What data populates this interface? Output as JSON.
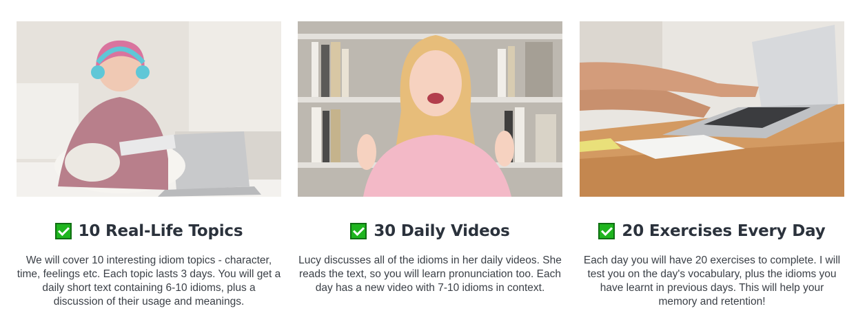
{
  "features": [
    {
      "image_alt": "Girl with headphones studying on bed with laptop",
      "title": "10 Real-Life Topics",
      "description": "We will cover 10 interesting idiom topics - character, time, feelings etc. Each topic lasts 3 days. You will get a daily short text containing 6-10 idioms, plus a discussion of their usage and meanings."
    },
    {
      "image_alt": "Smiling woman in pink sweater in front of bookshelf",
      "title": "30 Daily Videos",
      "description": "Lucy discusses all of the idioms in her daily videos. She reads the text, so you will learn pronunciation too. Each day has a new video with 7-10 idioms in context."
    },
    {
      "image_alt": "Hands typing on laptop at wooden desk",
      "title": "20 Exercises Every Day",
      "description": "Each day you will have 20 exercises to complete. I will test you on the day's vocabulary, plus the idioms you have learnt in previous days. This will help your memory and retention!"
    }
  ],
  "colors": {
    "check_green": "#1fb51f",
    "heading": "#2b323c",
    "text": "#3a3f46"
  },
  "icons": {
    "check": "checkbox-checked-icon"
  }
}
